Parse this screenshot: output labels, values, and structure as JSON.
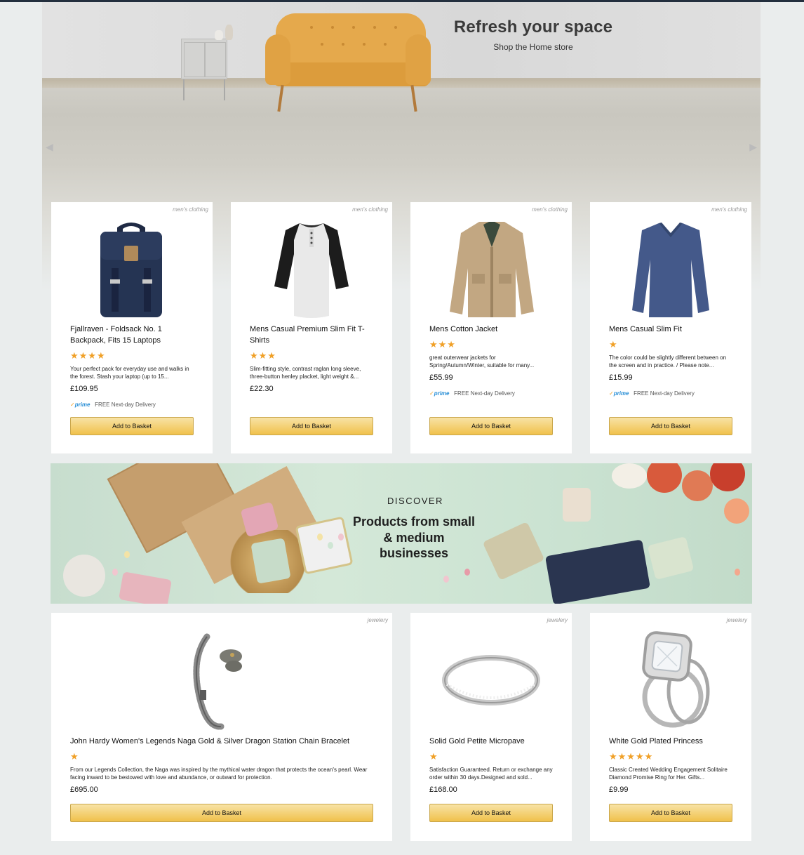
{
  "hero": {
    "title": "Refresh your space",
    "subtitle": "Shop the Home store",
    "prev_arrow": "◀",
    "next_arrow": "▶"
  },
  "products_row1": [
    {
      "category": "men's clothing",
      "title": "Fjallraven - Foldsack No. 1 Backpack, Fits 15 Laptops",
      "rating": 4,
      "stars": "★★★★",
      "description": "Your perfect pack for everyday use and walks in the forest. Stash your laptop (up to 15...",
      "price": "£109.95",
      "prime": true,
      "prime_label": "prime",
      "delivery": "FREE Next-day Delivery",
      "button": "Add to Basket",
      "icon": "backpack-icon"
    },
    {
      "category": "men's clothing",
      "title": "Mens Casual Premium Slim Fit T-Shirts",
      "rating": 3,
      "stars": "★★★",
      "description": "Slim-fitting style, contrast raglan long sleeve, three-button henley placket, light weight &...",
      "price": "£22.30",
      "prime": false,
      "button": "Add to Basket",
      "icon": "tshirt-icon"
    },
    {
      "category": "men's clothing",
      "title": "Mens Cotton Jacket",
      "rating": 3,
      "stars": "★★★",
      "description": "great outerwear jackets for Spring/Autumn/Winter, suitable for many...",
      "price": "£55.99",
      "prime": true,
      "prime_label": "prime",
      "delivery": "FREE Next-day Delivery",
      "button": "Add to Basket",
      "icon": "jacket-icon"
    },
    {
      "category": "men's clothing",
      "title": "Mens Casual Slim Fit",
      "rating": 1,
      "stars": "★",
      "description": "The color could be slightly different between on the screen and in practice. / Please note...",
      "price": "£15.99",
      "prime": true,
      "prime_label": "prime",
      "delivery": "FREE Next-day Delivery",
      "button": "Add to Basket",
      "icon": "sweater-icon"
    }
  ],
  "banner": {
    "kicker": "DISCOVER",
    "headline": "Products from small & medium businesses"
  },
  "products_row2": [
    {
      "category": "jewelery",
      "title": "John Hardy Women's Legends Naga Gold & Silver Dragon Station Chain Bracelet",
      "rating": 1,
      "stars": "★",
      "description": "From our Legends Collection, the Naga was inspired by the mythical water dragon that protects the ocean's pearl. Wear facing inward to be bestowed with love and abundance, or outward for protection.",
      "price": "£695.00",
      "button": "Add to Basket",
      "icon": "bracelet-icon"
    },
    {
      "category": "jewelery",
      "title": "Solid Gold Petite Micropave",
      "rating": 1,
      "stars": "★",
      "description": "Satisfaction Guaranteed. Return or exchange any order within 30 days.Designed and sold...",
      "price": "£168.00",
      "button": "Add to Basket",
      "icon": "ring-icon"
    },
    {
      "category": "jewelery",
      "title": "White Gold Plated Princess",
      "rating": 5,
      "stars": "★★★★★",
      "description": "Classic Created Wedding Engagement Solitaire Diamond Promise Ring for Her. Gifts...",
      "price": "£9.99",
      "button": "Add to Basket",
      "icon": "diamond-ring-icon"
    }
  ],
  "colors": {
    "star": "#f0a027",
    "button_top": "#f8e3a6",
    "button_bottom": "#f0c14b",
    "page_bg": "#eaeded",
    "prime_blue": "#2a8fd6"
  }
}
